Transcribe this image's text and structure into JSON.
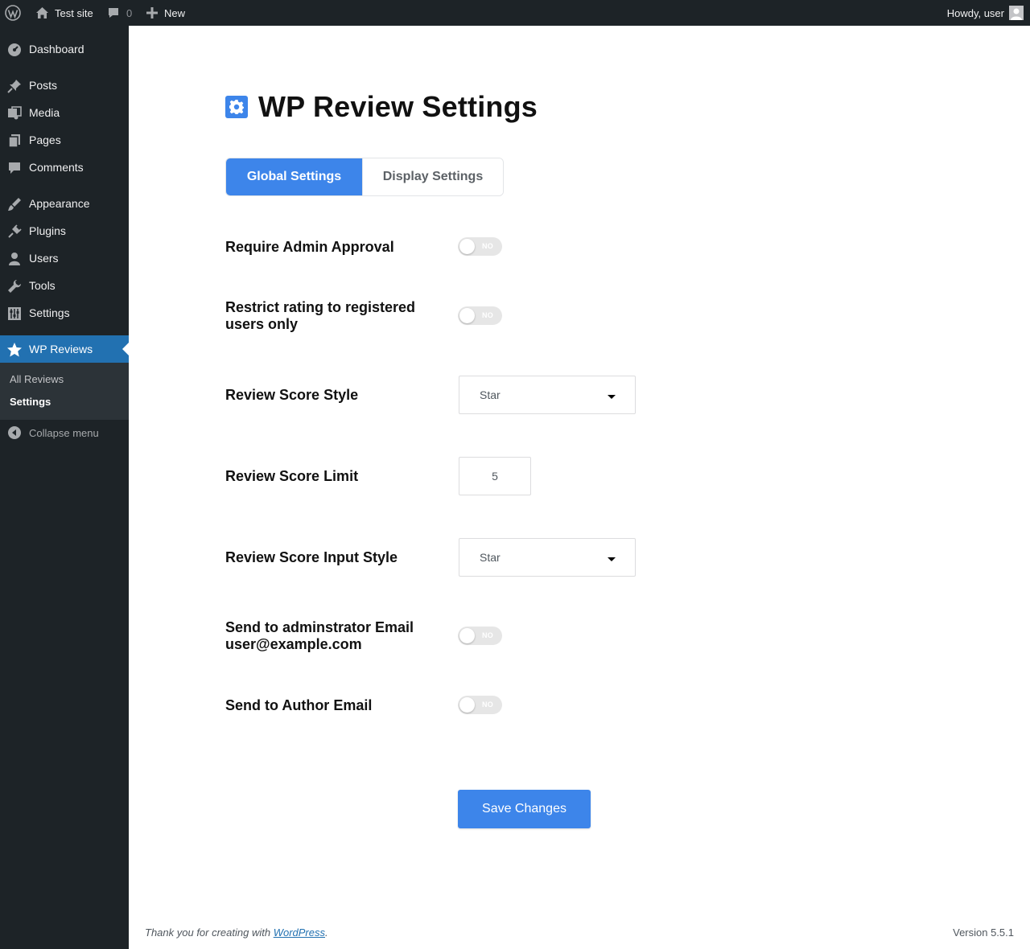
{
  "admin_bar": {
    "site_name": "Test site",
    "comments_count": "0",
    "new_label": "New",
    "howdy": "Howdy, user"
  },
  "sidebar": {
    "items": [
      {
        "label": "Dashboard",
        "icon": "dashboard-icon"
      },
      {
        "label": "Posts",
        "icon": "pin-icon"
      },
      {
        "label": "Media",
        "icon": "media-icon"
      },
      {
        "label": "Pages",
        "icon": "pages-icon"
      },
      {
        "label": "Comments",
        "icon": "comment-icon"
      },
      {
        "label": "Appearance",
        "icon": "brush-icon"
      },
      {
        "label": "Plugins",
        "icon": "plug-icon"
      },
      {
        "label": "Users",
        "icon": "user-icon"
      },
      {
        "label": "Tools",
        "icon": "wrench-icon"
      },
      {
        "label": "Settings",
        "icon": "sliders-icon"
      },
      {
        "label": "WP Reviews",
        "icon": "star-icon",
        "active": true
      }
    ],
    "submenu": [
      "All Reviews",
      "Settings"
    ],
    "collapse_label": "Collapse menu"
  },
  "main": {
    "title": "WP Review Settings",
    "tabs": [
      "Global Settings",
      "Display Settings"
    ],
    "settings": {
      "require_admin_approval": {
        "label": "Require Admin Approval",
        "state": "NO"
      },
      "restrict_rating": {
        "label": "Restrict rating to registered users only",
        "state": "NO"
      },
      "score_style": {
        "label": "Review Score Style",
        "value": "Star"
      },
      "score_limit": {
        "label": "Review Score Limit",
        "value": "5"
      },
      "score_input_style": {
        "label": "Review Score Input Style",
        "value": "Star"
      },
      "send_admin_email": {
        "label": "Send to adminstrator Email user@example.com",
        "state": "NO"
      },
      "send_author_email": {
        "label": "Send to Author Email",
        "state": "NO"
      }
    },
    "save_label": "Save Changes"
  },
  "footer": {
    "thanks_prefix": "Thank you for creating with ",
    "link": "WordPress",
    "suffix": ".",
    "version": "Version 5.5.1"
  },
  "colors": {
    "accent": "#3d85ea",
    "admin_dark": "#1d2327",
    "menu_active": "#2271b1"
  }
}
